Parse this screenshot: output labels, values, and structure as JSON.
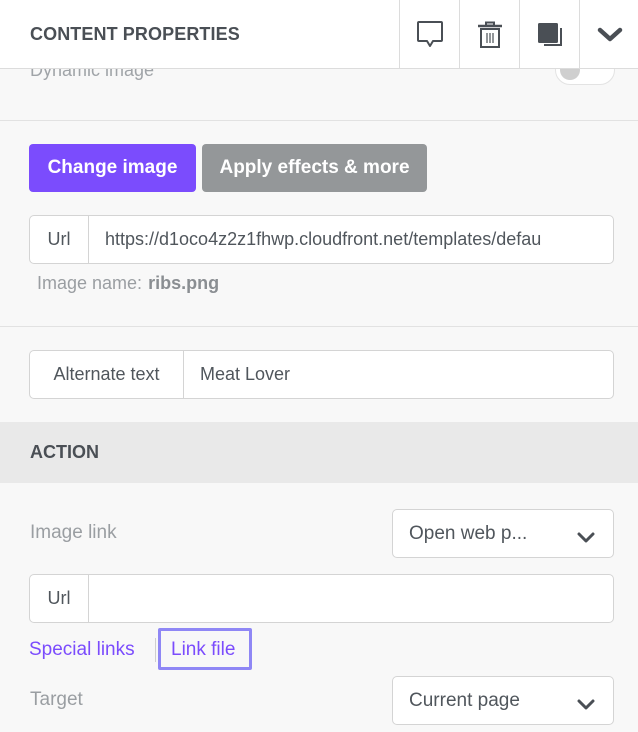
{
  "header": {
    "title": "CONTENT PROPERTIES",
    "actions": [
      {
        "name": "comment",
        "icon": "comment-icon"
      },
      {
        "name": "delete",
        "icon": "trash-icon"
      },
      {
        "name": "duplicate",
        "icon": "duplicate-icon"
      },
      {
        "name": "collapse",
        "icon": "chevron-down-icon"
      }
    ]
  },
  "dynamic_image": {
    "label": "Dynamic image",
    "enabled": false
  },
  "image": {
    "change_button": "Change image",
    "effects_button": "Apply effects & more",
    "url_label": "Url",
    "url_value": "https://d1oco4z2z1fhwp.cloudfront.net/templates/defau",
    "name_label": "Image name:",
    "name_value": "ribs.png"
  },
  "alt_text": {
    "label": "Alternate text",
    "value": "Meat Lover"
  },
  "action": {
    "title": "ACTION",
    "image_link_label": "Image link",
    "image_link_value": "Open web p...",
    "url_label": "Url",
    "url_value": "",
    "special_links": "Special links",
    "link_file": "Link file",
    "target_label": "Target",
    "target_value": "Current page"
  },
  "colors": {
    "primary": "#7b4cfd",
    "secondary_button": "#949799",
    "focus_ring": "#8f87f5"
  }
}
